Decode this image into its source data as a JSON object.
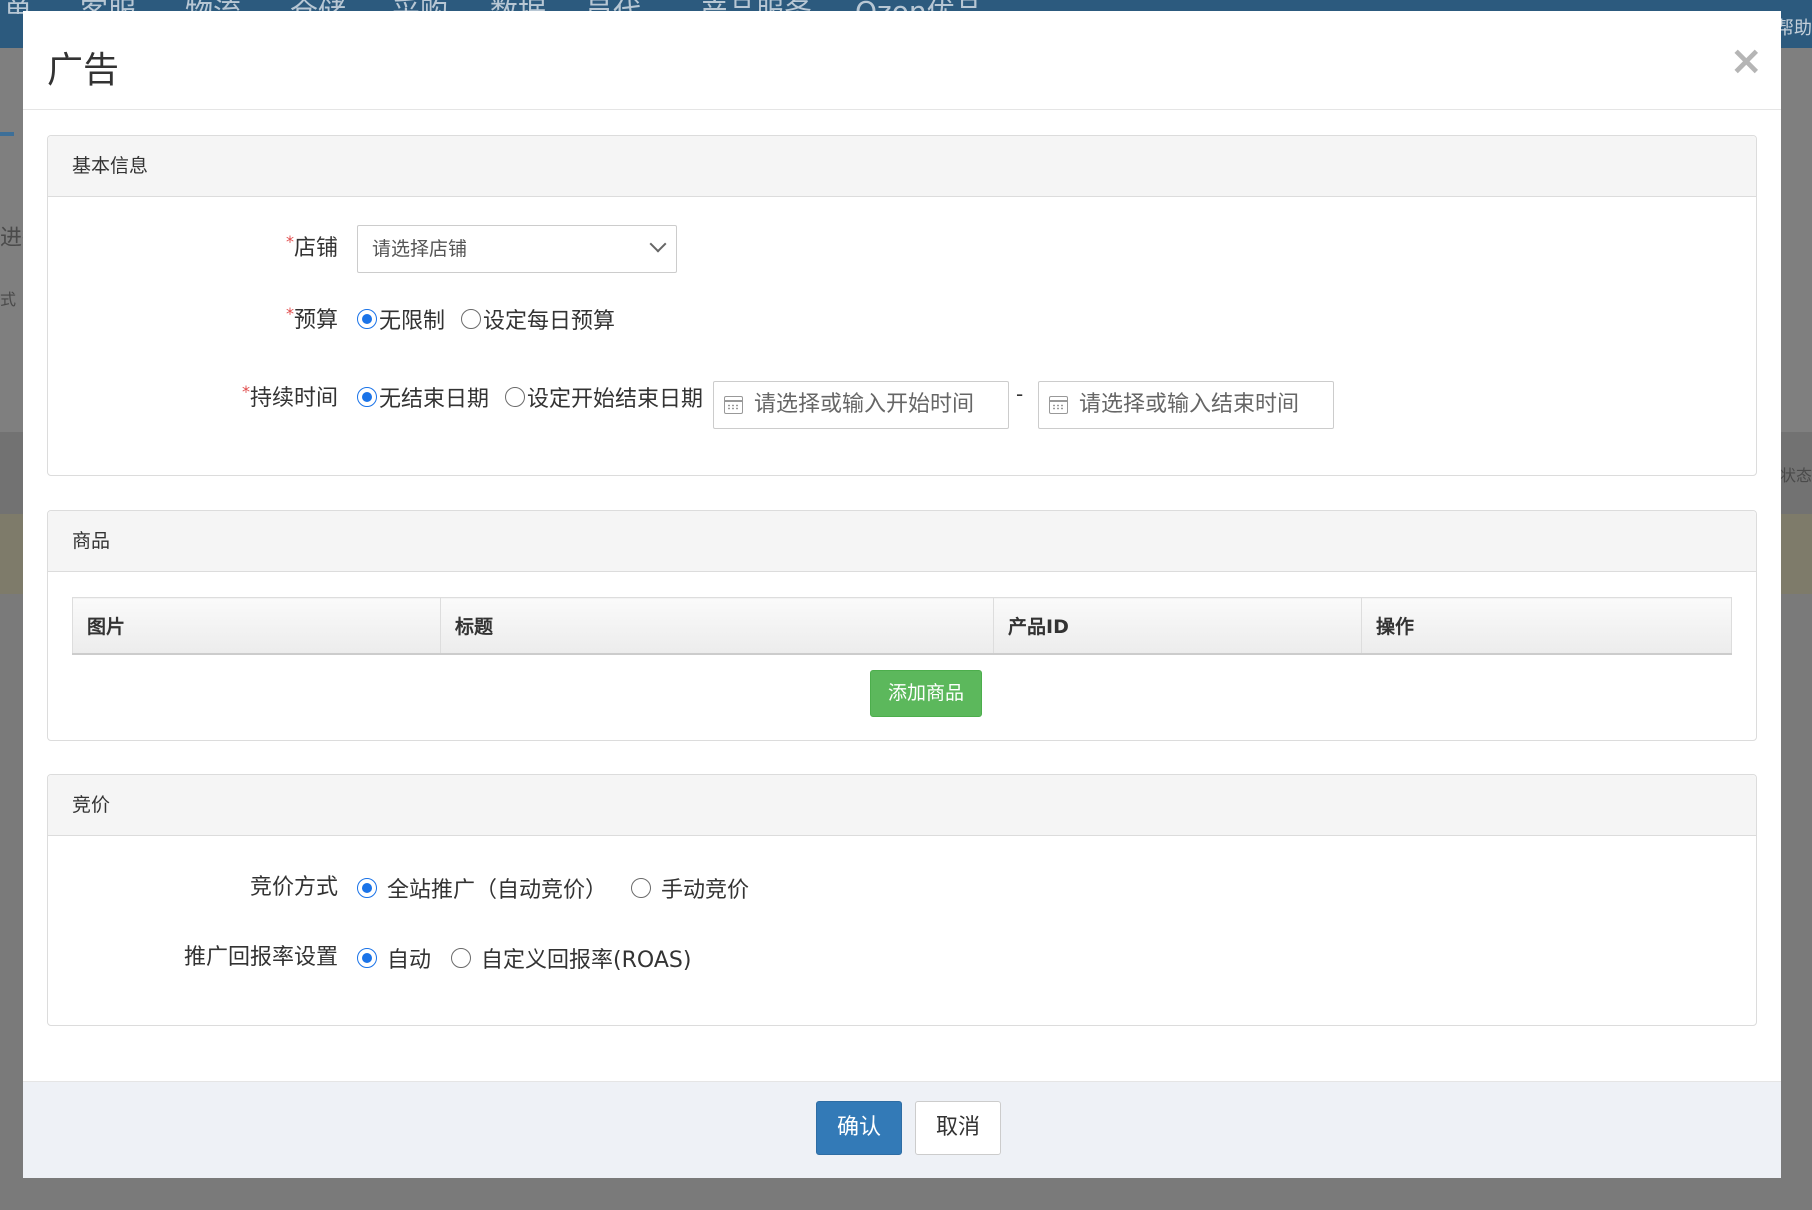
{
  "background": {
    "nav_items": [
      "单",
      "客服",
      "物流",
      "仓储",
      "采购",
      "数据",
      "员代",
      "产品服务",
      "Ozon优品"
    ],
    "help": "帮助",
    "left_text_1": "进行",
    "left_text_2": "式",
    "right_text": "状态"
  },
  "modal": {
    "title": "广告",
    "close_icon": "×"
  },
  "basic_info": {
    "heading": "基本信息",
    "store": {
      "required_mark": "*",
      "label": "店铺",
      "placeholder": "请选择店铺"
    },
    "budget": {
      "required_mark": "*",
      "label": "预算",
      "options": [
        {
          "label": "无限制",
          "selected": true
        },
        {
          "label": "设定每日预算",
          "selected": false
        }
      ]
    },
    "duration": {
      "required_mark": "*",
      "label": "持续时间",
      "options": [
        {
          "label": "无结束日期",
          "selected": true
        },
        {
          "label": "设定开始结束日期",
          "selected": false
        }
      ],
      "start_placeholder": "请选择或输入开始时间",
      "separator": "-",
      "end_placeholder": "请选择或输入结束时间"
    }
  },
  "products": {
    "heading": "商品",
    "columns": [
      "图片",
      "标题",
      "产品ID",
      "操作"
    ],
    "add_button": "添加商品"
  },
  "bidding": {
    "heading": "竞价",
    "method": {
      "label": "竞价方式",
      "options": [
        {
          "label": "全站推广（自动竞价）",
          "selected": true
        },
        {
          "label": "手动竞价",
          "selected": false
        }
      ]
    },
    "roas": {
      "label": "推广回报率设置",
      "options": [
        {
          "label": "自动",
          "selected": true
        },
        {
          "label": "自定义回报率(ROAS)",
          "selected": false
        }
      ]
    }
  },
  "footer": {
    "confirm": "确认",
    "cancel": "取消"
  },
  "colors": {
    "primary": "#337ab7",
    "success": "#5cb85c",
    "radio_active": "#1a73e8",
    "required": "#e04b4b"
  }
}
